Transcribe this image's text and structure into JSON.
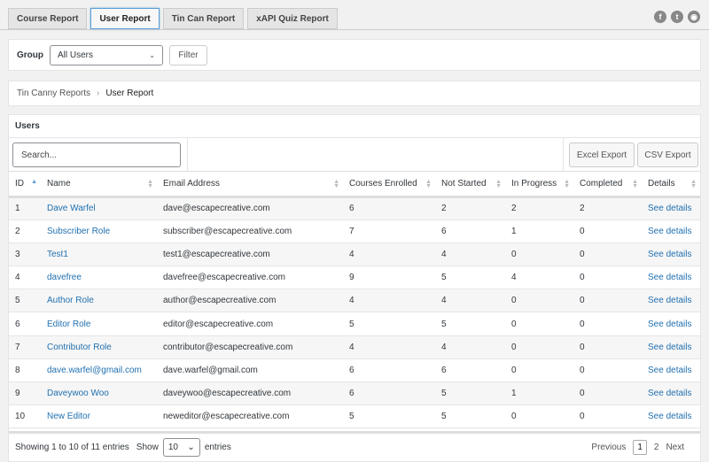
{
  "tabs": [
    {
      "label": "Course Report",
      "active": false
    },
    {
      "label": "User Report",
      "active": true
    },
    {
      "label": "Tin Can Report",
      "active": false
    },
    {
      "label": "xAPI Quiz Report",
      "active": false
    }
  ],
  "social_icons": [
    "facebook-icon",
    "twitter-icon",
    "web-icon"
  ],
  "filter": {
    "label": "Group",
    "selected": "All Users",
    "button": "Filter"
  },
  "breadcrumb": {
    "parent": "Tin Canny Reports",
    "separator": "›",
    "current": "User Report"
  },
  "users": {
    "title": "Users",
    "search_placeholder": "Search...",
    "excel_export": "Excel Export",
    "csv_export": "CSV Export",
    "columns": [
      "ID",
      "Name",
      "Email Address",
      "Courses Enrolled",
      "Not Started",
      "In Progress",
      "Completed",
      "Details"
    ],
    "rows": [
      {
        "id": "1",
        "name": "Dave Warfel",
        "email": "dave@escapecreative.com",
        "enrolled": "6",
        "not_started": "2",
        "in_progress": "2",
        "completed": "2",
        "details": "See details"
      },
      {
        "id": "2",
        "name": "Subscriber Role",
        "email": "subscriber@escapecreative.com",
        "enrolled": "7",
        "not_started": "6",
        "in_progress": "1",
        "completed": "0",
        "details": "See details"
      },
      {
        "id": "3",
        "name": "Test1",
        "email": "test1@escapecreative.com",
        "enrolled": "4",
        "not_started": "4",
        "in_progress": "0",
        "completed": "0",
        "details": "See details"
      },
      {
        "id": "4",
        "name": "davefree",
        "email": "davefree@escapecreative.com",
        "enrolled": "9",
        "not_started": "5",
        "in_progress": "4",
        "completed": "0",
        "details": "See details"
      },
      {
        "id": "5",
        "name": "Author Role",
        "email": "author@escapecreative.com",
        "enrolled": "4",
        "not_started": "4",
        "in_progress": "0",
        "completed": "0",
        "details": "See details"
      },
      {
        "id": "6",
        "name": "Editor Role",
        "email": "editor@escapecreative.com",
        "enrolled": "5",
        "not_started": "5",
        "in_progress": "0",
        "completed": "0",
        "details": "See details"
      },
      {
        "id": "7",
        "name": "Contributor Role",
        "email": "contributor@escapecreative.com",
        "enrolled": "4",
        "not_started": "4",
        "in_progress": "0",
        "completed": "0",
        "details": "See details"
      },
      {
        "id": "8",
        "name": "dave.warfel@gmail.com",
        "email": "dave.warfel@gmail.com",
        "enrolled": "6",
        "not_started": "6",
        "in_progress": "0",
        "completed": "0",
        "details": "See details"
      },
      {
        "id": "9",
        "name": "Daveywoo Woo",
        "email": "daveywoo@escapecreative.com",
        "enrolled": "6",
        "not_started": "5",
        "in_progress": "1",
        "completed": "0",
        "details": "See details"
      },
      {
        "id": "10",
        "name": "New Editor",
        "email": "neweditor@escapecreative.com",
        "enrolled": "5",
        "not_started": "5",
        "in_progress": "0",
        "completed": "0",
        "details": "See details"
      }
    ]
  },
  "footer": {
    "info": "Showing 1 to 10 of 11 entries",
    "show_label": "Show",
    "page_size": "10",
    "entries_label": "entries",
    "previous": "Previous",
    "pages": [
      "1",
      "2"
    ],
    "current_page": "1",
    "next": "Next"
  },
  "colors": {
    "link": "#2271b1",
    "active_tab_border": "#5b9dd9"
  }
}
